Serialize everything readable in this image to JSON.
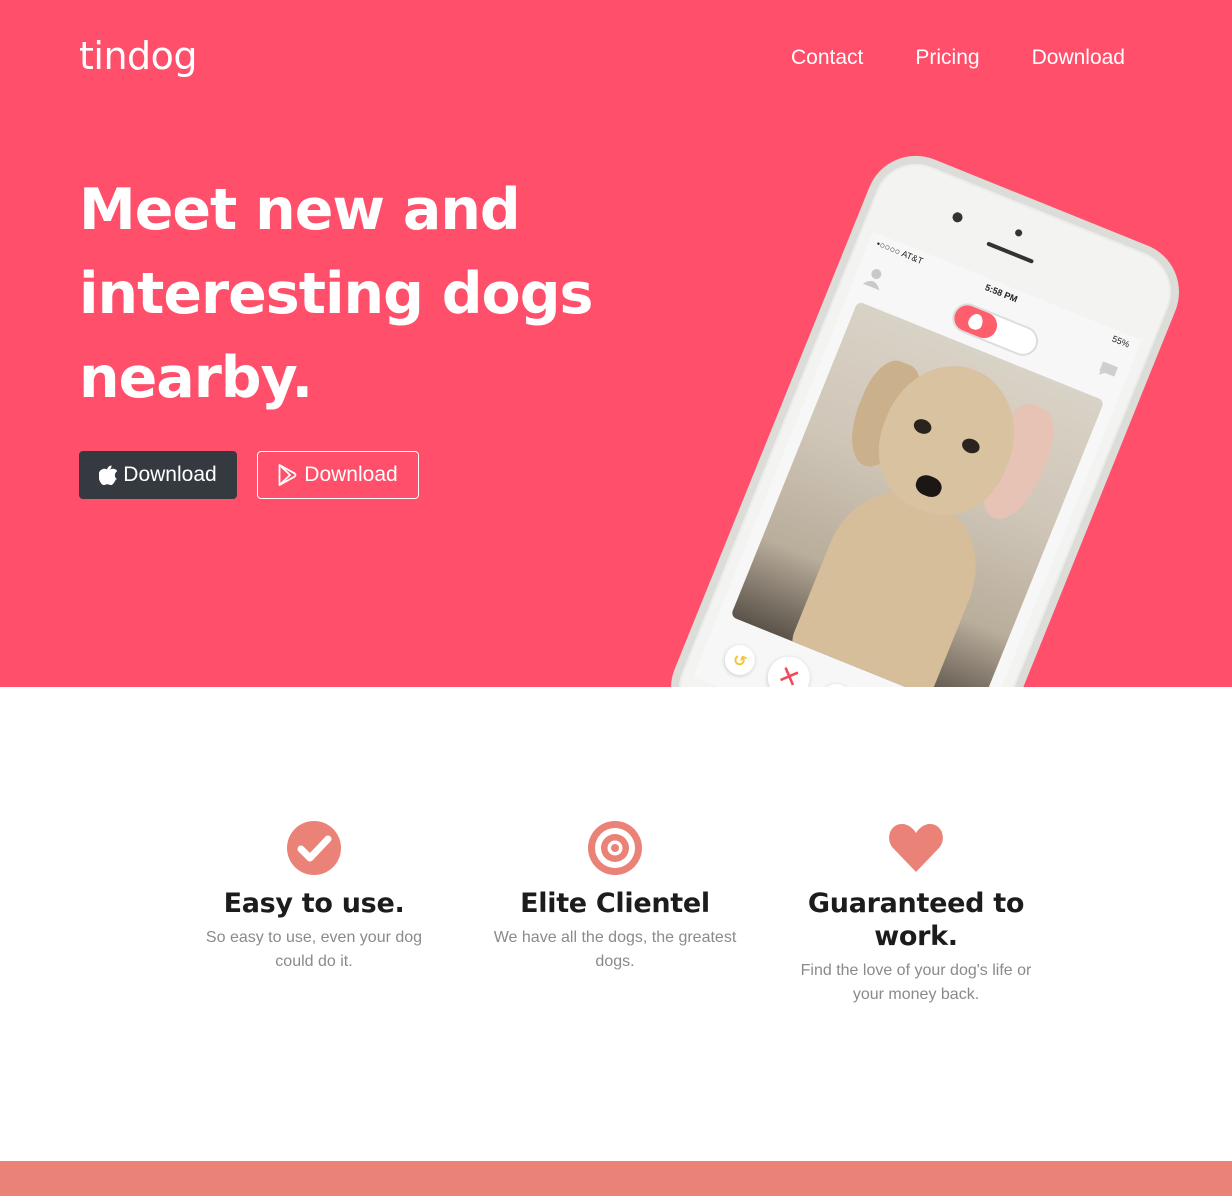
{
  "colors": {
    "hero_background": "#ff4f6a",
    "feature_accent": "#ea8277",
    "dark_button": "#343a40",
    "footer_band": "#ea8277"
  },
  "header": {
    "brand": "tindog",
    "nav": [
      {
        "label": "Contact"
      },
      {
        "label": "Pricing"
      },
      {
        "label": "Download"
      }
    ]
  },
  "hero": {
    "headline": "Meet new and interesting dogs nearby.",
    "buttons": {
      "apple": {
        "label": "Download",
        "icon": "apple-icon"
      },
      "play": {
        "label": "Download",
        "icon": "google-play-icon"
      }
    },
    "phone": {
      "carrier": "•○○○○ AT&T",
      "time": "5:58 PM",
      "battery": "55%"
    }
  },
  "features": [
    {
      "icon": "check-circle-icon",
      "title": "Easy to use.",
      "text": "So easy to use, even your dog could do it."
    },
    {
      "icon": "bullseye-icon",
      "title": "Elite Clientel",
      "text": "We have all the dogs, the greatest dogs."
    },
    {
      "icon": "heart-icon",
      "title": "Guaranteed to work.",
      "text": "Find the love of your dog's life or your money back."
    }
  ]
}
